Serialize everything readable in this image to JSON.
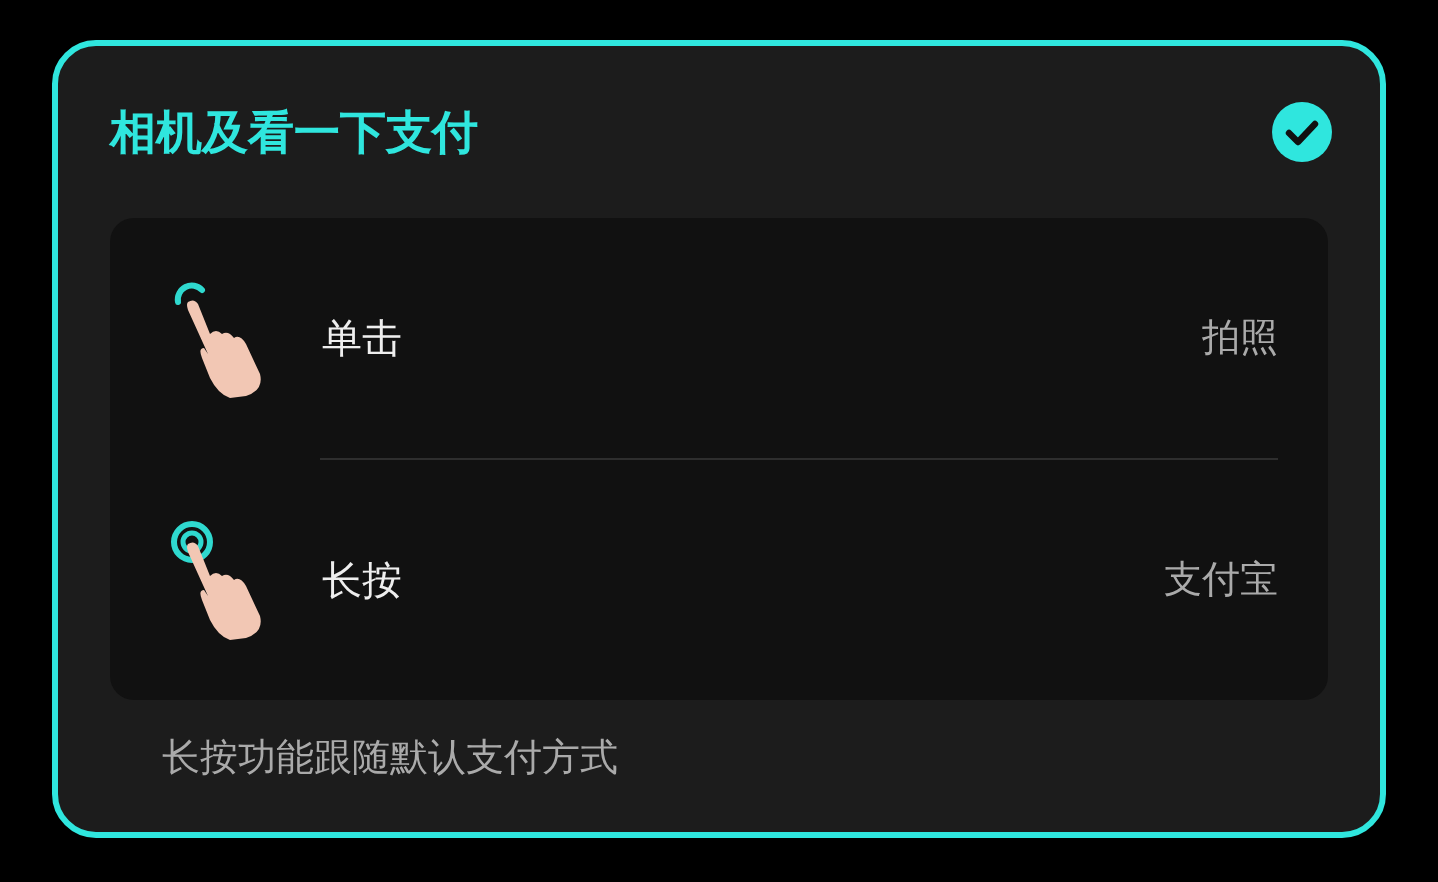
{
  "card": {
    "title": "相机及看一下支付",
    "checked": true,
    "actions": [
      {
        "kind": "tap",
        "label": "单击",
        "value": "拍照"
      },
      {
        "kind": "long-press",
        "label": "长按",
        "value": "支付宝"
      }
    ],
    "note": "长按功能跟随默认支付方式"
  }
}
